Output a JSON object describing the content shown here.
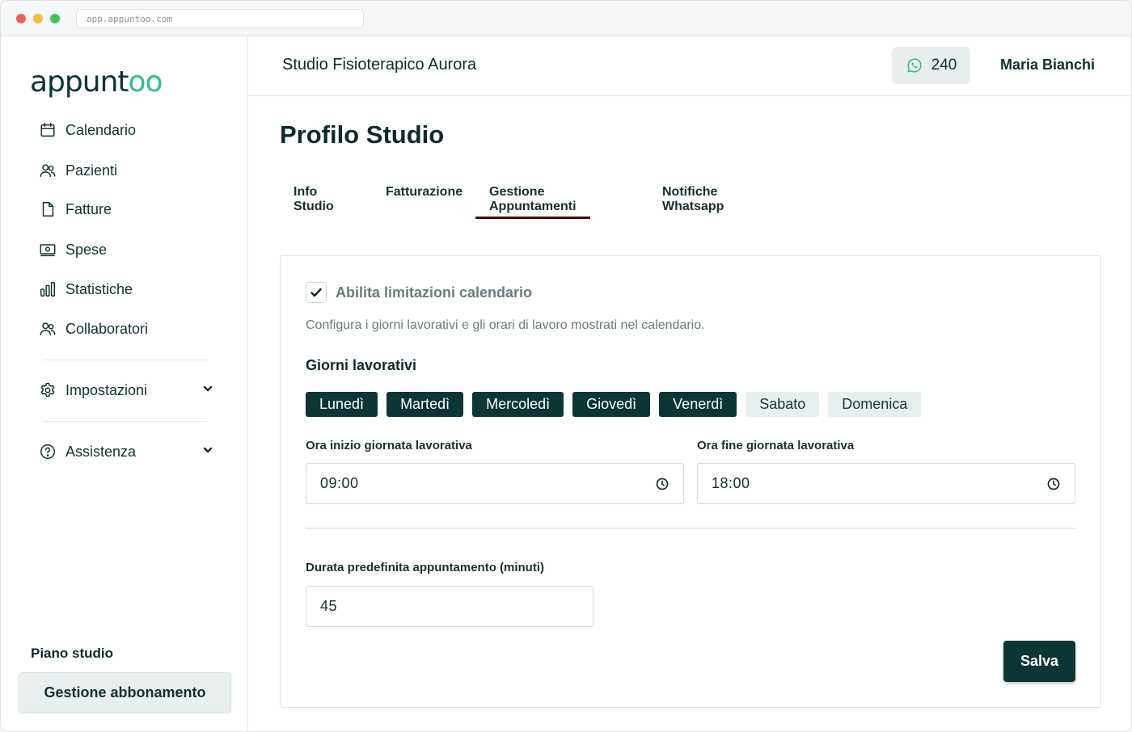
{
  "browser": {
    "url": "app.appuntoo.com"
  },
  "brand": {
    "logo_main": "appunt",
    "logo_accent": "oo",
    "accent_color": "#2fbf8a",
    "primary_color": "#0d3535"
  },
  "sidebar": {
    "items": [
      {
        "label": "Calendario",
        "icon": "calendar-icon"
      },
      {
        "label": "Pazienti",
        "icon": "users-icon"
      },
      {
        "label": "Fatture",
        "icon": "document-icon"
      },
      {
        "label": "Spese",
        "icon": "banknote-icon"
      },
      {
        "label": "Statistiche",
        "icon": "bar-chart-icon"
      },
      {
        "label": "Collaboratori",
        "icon": "users-icon"
      }
    ],
    "groups": [
      {
        "label": "Impostazioni",
        "icon": "gear-icon"
      },
      {
        "label": "Assistenza",
        "icon": "help-icon"
      }
    ],
    "plan_title": "Piano studio",
    "plan_button": "Gestione abbonamento"
  },
  "header": {
    "studio_name": "Studio Fisioterapico Aurora",
    "whatsapp_count": "240",
    "user_name": "Maria Bianchi"
  },
  "main": {
    "title": "Profilo Studio",
    "tabs": [
      {
        "label": "Info Studio"
      },
      {
        "label": "Fatturazione"
      },
      {
        "label": "Gestione Appuntamenti"
      },
      {
        "label": "Notifiche Whatsapp"
      }
    ],
    "active_tab": "Gestione Appuntamenti"
  },
  "form": {
    "checkbox_label": "Abilita limitazioni calendario",
    "checkbox_checked": true,
    "description": "Configura i giorni lavorativi e gli orari di lavoro mostrati nel calendario.",
    "days_title": "Giorni lavorativi",
    "days": [
      {
        "label": "Lunedì",
        "selected": true
      },
      {
        "label": "Martedì",
        "selected": true
      },
      {
        "label": "Mercoledì",
        "selected": true
      },
      {
        "label": "Giovedì",
        "selected": true
      },
      {
        "label": "Venerdì",
        "selected": true
      },
      {
        "label": "Sabato",
        "selected": false
      },
      {
        "label": "Domenica",
        "selected": false
      }
    ],
    "start_label": "Ora inizio giornata lavorativa",
    "start_value": "09:00",
    "end_label": "Ora fine giornata lavorativa",
    "end_value": "18:00",
    "duration_label": "Durata predefinita appuntamento (minuti)",
    "duration_value": "45",
    "save_label": "Salva"
  }
}
